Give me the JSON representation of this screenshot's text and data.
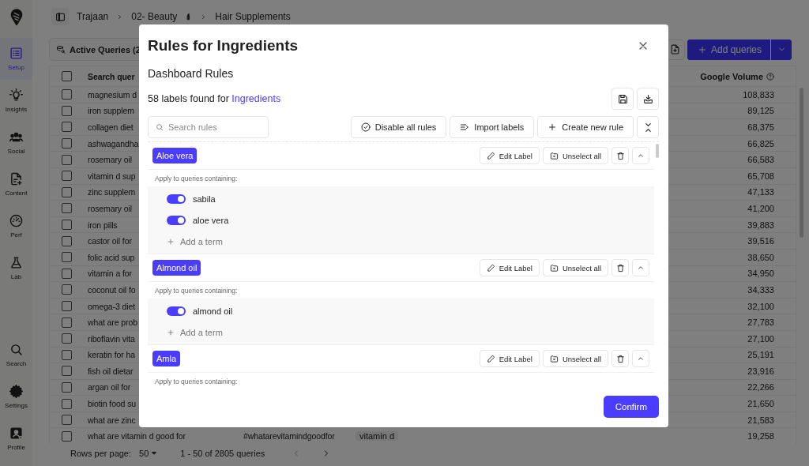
{
  "sidebar": {
    "items": [
      {
        "label": "Setup",
        "selected": true
      },
      {
        "label": "Insights",
        "selected": false
      },
      {
        "label": "Social",
        "selected": false
      },
      {
        "label": "Content",
        "selected": false
      },
      {
        "label": "Perf",
        "selected": false
      },
      {
        "label": "Lab",
        "selected": false
      },
      {
        "label": "Search",
        "selected": false
      },
      {
        "label": "Settings",
        "selected": false
      },
      {
        "label": "Profile",
        "selected": false
      }
    ]
  },
  "breadcrumb": [
    "Trajaan",
    "02- Beauty",
    "Hair Supplements"
  ],
  "toolbar": {
    "tab": "Active Queries (2",
    "add_button": "Add queries"
  },
  "table": {
    "header_checked": false,
    "columns": [
      "Search quer",
      "Google Volume"
    ],
    "rows": [
      {
        "query": "magnesium d",
        "volume": "108,833",
        "checked": false
      },
      {
        "query": "iron supplem",
        "volume": "89,125",
        "checked": false
      },
      {
        "query": "collagen diet",
        "volume": "68,375",
        "checked": false
      },
      {
        "query": "ashwagandha",
        "volume": "66,825",
        "checked": false
      },
      {
        "query": "rosemary oil",
        "volume": "66,583",
        "checked": false
      },
      {
        "query": "vitamin d sup",
        "volume": "65,708",
        "checked": false
      },
      {
        "query": "zinc supplem",
        "volume": "47,133",
        "checked": false
      },
      {
        "query": "rosemary oil",
        "volume": "41,200",
        "checked": false
      },
      {
        "query": "iron pills",
        "volume": "39,883",
        "checked": false
      },
      {
        "query": "castor oil for",
        "volume": "39,516",
        "checked": false
      },
      {
        "query": "folic acid sup",
        "volume": "38,650",
        "checked": false
      },
      {
        "query": "vitamin a for",
        "volume": "34,950",
        "checked": false
      },
      {
        "query": "coconut oil fo",
        "volume": "34,333",
        "checked": false
      },
      {
        "query": "omega-3 diet",
        "volume": "32,100",
        "checked": false
      },
      {
        "query": "what are prob",
        "volume": "27,783",
        "checked": false
      },
      {
        "query": "riboflavin vita",
        "volume": "27,100",
        "checked": false
      },
      {
        "query": "keratin for ha",
        "volume": "25,191",
        "checked": false
      },
      {
        "query": "fish oil dietar",
        "volume": "23,916",
        "checked": false
      },
      {
        "query": "argan oil for",
        "volume": "22,266",
        "checked": false
      },
      {
        "query": "biotin food su",
        "volume": "21,650",
        "checked": false
      },
      {
        "query": "what are zinc",
        "volume": "21,583",
        "checked": false
      },
      {
        "query": "what are vitamin d good for",
        "column_2": "#whatarevitamindgoodfor",
        "column_3": "vitamin d",
        "volume": "19,258",
        "checked": false
      }
    ]
  },
  "pagination": {
    "rows_label": "Rows per page:",
    "rows_value": "50",
    "range": "1 - 50 of 2805 queries"
  },
  "modal": {
    "title": "Rules for Ingredients",
    "subtitle": "Dashboard Rules",
    "found_text": "58 labels found for",
    "found_link": "Ingredients",
    "search": {
      "placeholder": "Search rules"
    },
    "actions": [
      {
        "kind": "disable",
        "label": "Disable all rules"
      },
      {
        "kind": "import",
        "label": "Import labels"
      },
      {
        "kind": "create",
        "label": "Create new rule"
      }
    ],
    "rules": [
      {
        "label": "Aloe vera",
        "edit": "Edit Label",
        "unselect": "Unselect all",
        "caption": "Apply to queries containing:",
        "terms": [
          {
            "text": "sabila",
            "on": true
          },
          {
            "text": "aloe vera",
            "on": true
          }
        ],
        "add_term": "Add a term"
      },
      {
        "label": "Almond oil",
        "edit": "Edit Label",
        "unselect": "Unselect all",
        "caption": "Apply to queries containing:",
        "terms": [
          {
            "text": "almond oil",
            "on": true
          }
        ],
        "add_term": "Add a term"
      },
      {
        "label": "Amla",
        "edit": "Edit Label",
        "unselect": "Unselect all",
        "caption": "Apply to queries containing:"
      }
    ],
    "confirm": "Confirm"
  }
}
